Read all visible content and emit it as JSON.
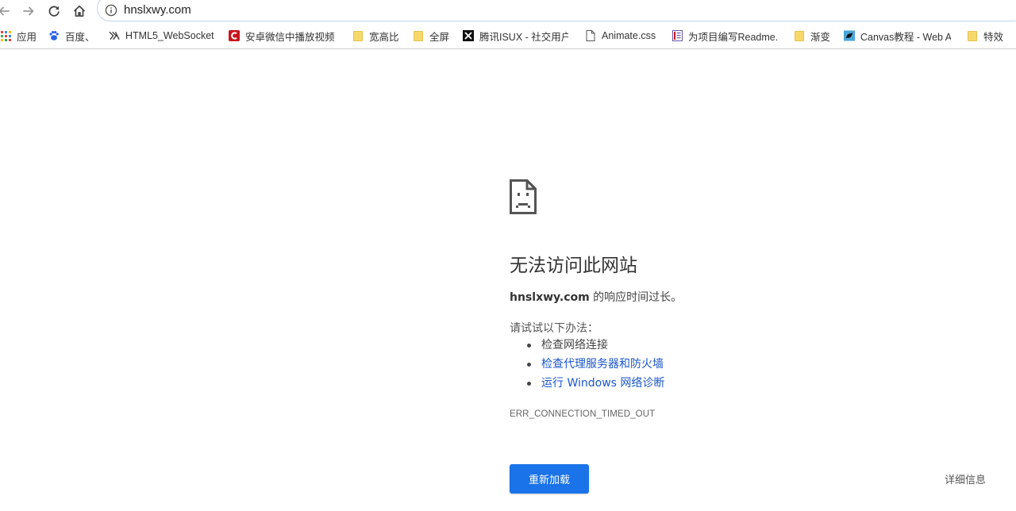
{
  "toolbar": {
    "url": "hnslxwy.com",
    "back_icon": "back-arrow-icon",
    "forward_icon": "forward-arrow-icon",
    "reload_icon": "reload-icon",
    "home_icon": "home-icon",
    "info_icon": "info-circle-icon"
  },
  "bookmarks": [
    {
      "label": "应用",
      "icon": "apps-grid-icon"
    },
    {
      "label": "百度、",
      "icon": "baidu-paw-icon"
    },
    {
      "label": "HTML5_WebSocket",
      "icon": "websocket-icon"
    },
    {
      "label": "安卓微信中播放视频",
      "icon": "csdn-icon"
    },
    {
      "label": "宽高比",
      "icon": "folder-icon"
    },
    {
      "label": "全屏",
      "icon": "folder-icon"
    },
    {
      "label": "腾讯ISUX - 社交用户",
      "icon": "isux-icon"
    },
    {
      "label": "Animate.css",
      "icon": "page-icon"
    },
    {
      "label": "为项目编写Readme.",
      "icon": "book-icon"
    },
    {
      "label": "渐变",
      "icon": "folder-icon"
    },
    {
      "label": "Canvas教程 - Web A",
      "icon": "mdn-icon"
    },
    {
      "label": "特效",
      "icon": "folder-icon"
    }
  ],
  "error": {
    "icon": "sad-page-icon",
    "title": "无法访问此网站",
    "domain": "hnslxwy.com",
    "summary_suffix": " 的响应时间过长。",
    "suggestions_heading": "请试试以下办法：",
    "suggestions": [
      {
        "text": "检查网络连接",
        "link": false
      },
      {
        "text": "检查代理服务器和防火墙",
        "link": true
      },
      {
        "text": "运行 Windows 网络诊断",
        "link": true
      }
    ],
    "code": "ERR_CONNECTION_TIMED_OUT",
    "reload_label": "重新加载",
    "details_label": "详细信息"
  },
  "colors": {
    "accent": "#1a73e8",
    "link": "#1a56c9",
    "folder": "#f7d96b"
  }
}
